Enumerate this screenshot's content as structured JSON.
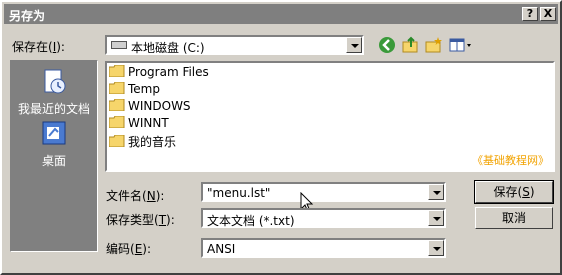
{
  "window": {
    "title": "另存为",
    "help_label": "?",
    "close_label": "X"
  },
  "location": {
    "label": "保存在",
    "accel": "I",
    "value": "本地磁盘 (C:)"
  },
  "places": [
    {
      "label": "我最近的文档",
      "icon": "recent-documents-icon"
    },
    {
      "label": "桌面",
      "icon": "desktop-icon"
    }
  ],
  "files": [
    {
      "name": "Program Files",
      "icon": "folder-icon"
    },
    {
      "name": "Temp",
      "icon": "folder-icon"
    },
    {
      "name": "WINDOWS",
      "icon": "folder-icon"
    },
    {
      "name": "WINNT",
      "icon": "folder-icon"
    },
    {
      "name": "我的音乐",
      "icon": "folder-icon"
    }
  ],
  "watermark": "《基础教程网》",
  "filename": {
    "label": "文件名",
    "accel": "N",
    "value": "\"menu.lst\""
  },
  "filetype": {
    "label": "保存类型",
    "accel": "T",
    "value": "文本文档 (*.txt)"
  },
  "encoding": {
    "label": "编码",
    "accel": "E",
    "value": "ANSI"
  },
  "buttons": {
    "save": "保存",
    "save_accel": "S",
    "cancel": "取消"
  },
  "colors": {
    "title_bar": "#7f7f7f",
    "places_bg": "#808080",
    "folder": "#f6d56b",
    "watermark": "#f2a300"
  }
}
